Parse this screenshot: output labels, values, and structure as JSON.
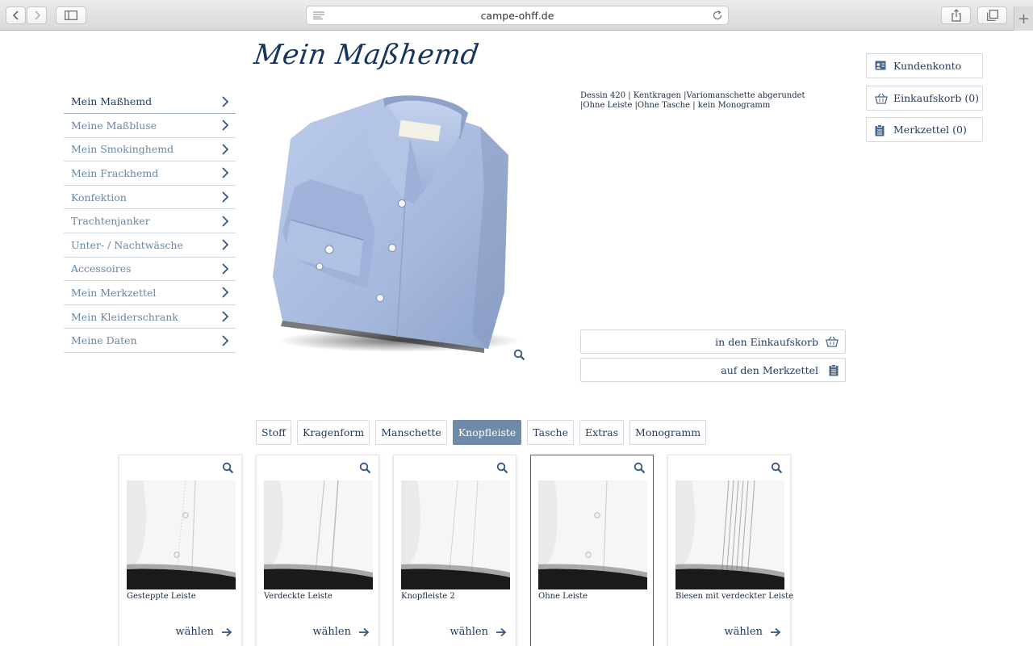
{
  "browser": {
    "url": "campe-ohff.de"
  },
  "logo": "Mein Maßhemd",
  "sidebar": {
    "items": [
      {
        "label": "Mein Maßhemd",
        "active": true
      },
      {
        "label": "Meine Maßbluse"
      },
      {
        "label": "Mein Smokinghemd"
      },
      {
        "label": "Mein Frackhemd"
      },
      {
        "label": "Konfektion"
      },
      {
        "label": "Trachtenjanker"
      },
      {
        "label": "Unter- / Nachtwäsche"
      },
      {
        "label": "Accessoires"
      },
      {
        "label": "Mein Merkzettel"
      },
      {
        "label": "Mein Kleiderschrank"
      },
      {
        "label": "Meine Daten"
      }
    ]
  },
  "product": {
    "config_summary": "Dessin 420 | Kentkragen |Variomanschette abgerundet |Ohne Leiste |Ohne Tasche | kein Monogramm",
    "add_to_cart": "in den Einkaufskorb",
    "add_to_wishlist": "auf den Merkzettel"
  },
  "account": {
    "customer_account": "Kundenkonto",
    "cart": "Einkaufskorb (0)",
    "wishlist": "Merkzettel (0)"
  },
  "tabs": [
    {
      "label": "Stoff"
    },
    {
      "label": "Kragenform"
    },
    {
      "label": "Manschette"
    },
    {
      "label": "Knopfleiste",
      "active": true
    },
    {
      "label": "Tasche"
    },
    {
      "label": "Extras"
    },
    {
      "label": "Monogramm"
    }
  ],
  "options": [
    {
      "name": "Gesteppte Leiste",
      "choose": "wählen"
    },
    {
      "name": "Verdeckte Leiste",
      "choose": "wählen"
    },
    {
      "name": "Knopfleiste 2",
      "choose": "wählen"
    },
    {
      "name": "Ohne Leiste",
      "choose": "",
      "selected": true
    },
    {
      "name": "Biesen mit verdeckter Leiste",
      "choose": "wählen"
    }
  ],
  "colors": {
    "primary": "#1f3a5f",
    "muted": "#6b86a3",
    "active_tab": "#6f8aa8",
    "shirt": "#a9bde2"
  }
}
